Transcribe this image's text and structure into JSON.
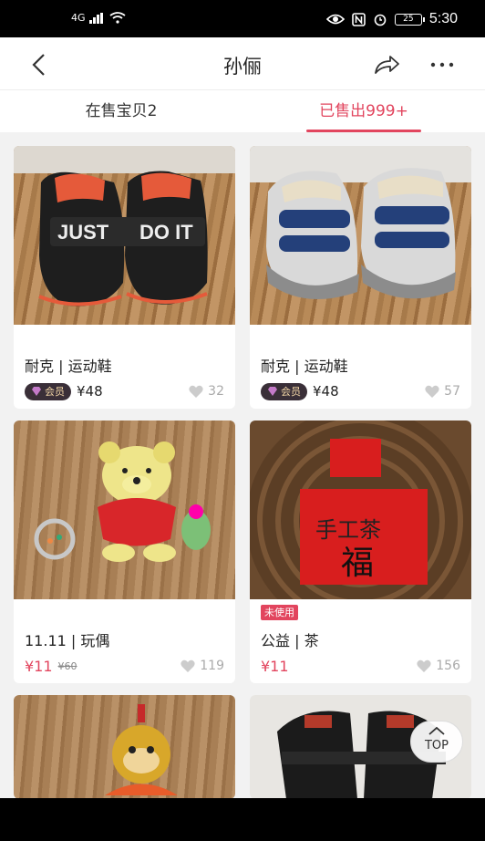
{
  "status_bar": {
    "network": "4G",
    "battery": "25",
    "time": "5:30"
  },
  "header": {
    "title": "孙俪",
    "back_icon": "back-arrow-icon",
    "share_icon": "share-icon",
    "more_icon": "more-icon"
  },
  "tabs": [
    {
      "label": "在售宝贝2",
      "active": false
    },
    {
      "label": "已售出999+",
      "active": true
    }
  ],
  "items": [
    {
      "title": "耐克 | 运动鞋",
      "vip_label": "会员",
      "price": "¥48",
      "likes": "32"
    },
    {
      "title": "耐克 | 运动鞋",
      "vip_label": "会员",
      "price": "¥48",
      "likes": "57"
    },
    {
      "title": "11.11 | 玩偶",
      "price": "¥11",
      "original_price": "¥60",
      "likes": "119"
    },
    {
      "title": "公益 | 茶",
      "tag": "未使用",
      "price": "¥11",
      "likes": "156"
    }
  ],
  "top_button": "TOP",
  "colors": {
    "accent": "#e2455e"
  }
}
